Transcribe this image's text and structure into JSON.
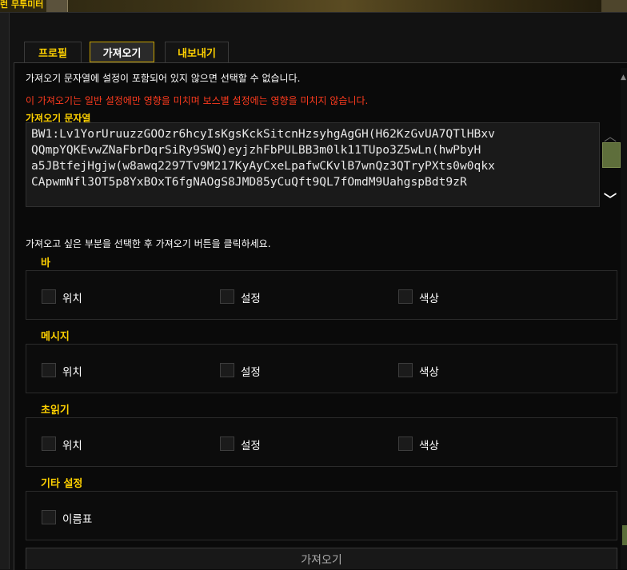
{
  "window": {
    "title_fragment": "런 무투미터"
  },
  "tabs": [
    {
      "label": "프로필",
      "active": false
    },
    {
      "label": "가져오기",
      "active": true
    },
    {
      "label": "내보내기",
      "active": false
    }
  ],
  "info_text": "가져오기 문자열에 설정이 포함되어 있지 않으면 선택할 수 없습니다.",
  "warning_text": "이 가져오기는 일반 설정에만 영향을 미치며 보스별 설정에는 영향을 미치지 않습니다.",
  "import_string": {
    "label": "가져오기 문자열",
    "lines": [
      "BW1:Lv1YorUruuzzGOOzr6hcyIsKgsKckSitcnHzsyhgAgGH(H62KzGvUA7QTlHBxv",
      "QQmpYQKEvwZNaFbrDqrSiRy9SWQ)eyjzhFbPULBB3m0lk11TUpo3Z5wLn(hwPbyH",
      "a5JBtfejHgjw(w8awq2297Tv9M217KyAyCxeLpafwCKvlB7wnQz3QTryPXts0w0qkx",
      "CApwmNfl3OT5p8YxBOxT6fgNAOgS8JMD85yCuQft9QL7fOmdM9UahgspBdt9zR"
    ]
  },
  "instruction": "가져오고 싶은 부분을 선택한 후 가져오기 버튼을 클릭하세요.",
  "sections": [
    {
      "title": "바",
      "options": [
        {
          "label": "위치",
          "checked": false
        },
        {
          "label": "설정",
          "checked": false
        },
        {
          "label": "색상",
          "checked": false
        }
      ]
    },
    {
      "title": "메시지",
      "options": [
        {
          "label": "위치",
          "checked": false
        },
        {
          "label": "설정",
          "checked": false
        },
        {
          "label": "색상",
          "checked": false
        }
      ]
    },
    {
      "title": "초읽기",
      "options": [
        {
          "label": "위치",
          "checked": false
        },
        {
          "label": "설정",
          "checked": false
        },
        {
          "label": "색상",
          "checked": false
        }
      ]
    },
    {
      "title": "기타 설정",
      "options": [
        {
          "label": "이름표",
          "checked": false
        }
      ]
    }
  ],
  "import_button": {
    "label": "가져오기"
  },
  "colors": {
    "gold": "#ffd100",
    "warning": "#ff3b1e",
    "panel_bg": "#0a0a0a",
    "active_tab_border": "#c9a300"
  },
  "icons": {
    "scroll_up": "chevron-up-icon",
    "scroll_down": "chevron-down-icon"
  }
}
